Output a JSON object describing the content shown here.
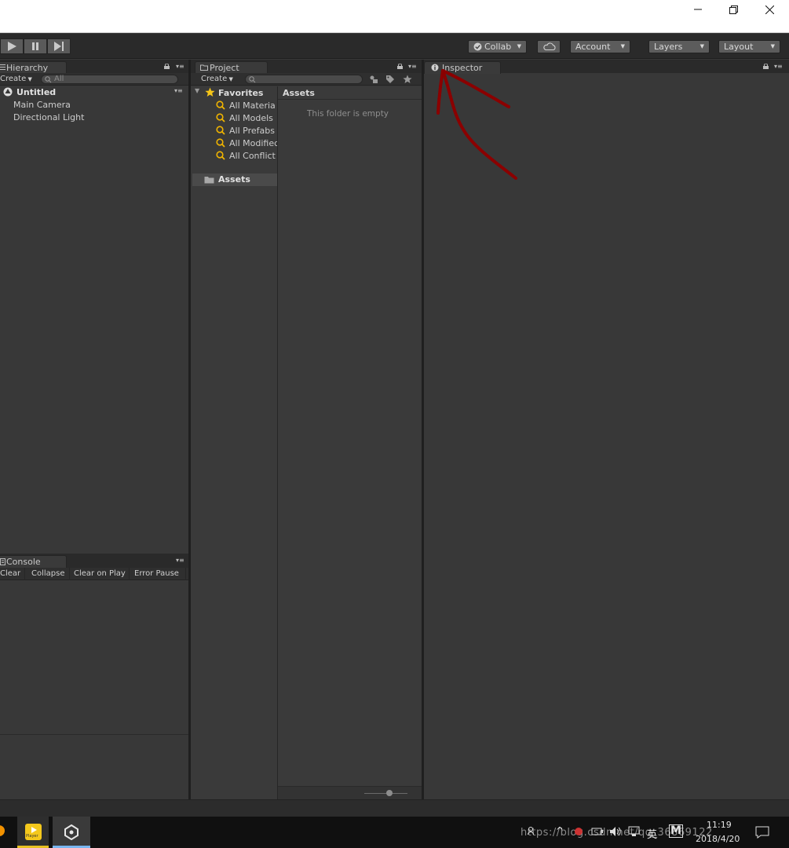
{
  "window": {
    "minimize": "minimize",
    "restore": "restore",
    "close": "close"
  },
  "toolbar": {
    "collab_label": "Collab",
    "account_label": "Account",
    "layers_label": "Layers",
    "layout_label": "Layout"
  },
  "hierarchy": {
    "tab_label": "Hierarchy",
    "create_label": "Create",
    "search_placeholder": "All",
    "scene_name": "Untitled",
    "items": [
      "Main Camera",
      "Directional Light"
    ]
  },
  "project": {
    "tab_label": "Project",
    "create_label": "Create",
    "favorites_label": "Favorites",
    "favorites": [
      "All Materia",
      "All Models",
      "All Prefabs",
      "All Modified",
      "All Conflict"
    ],
    "assets_label": "Assets",
    "breadcrumb": "Assets",
    "empty_message": "This folder is empty"
  },
  "inspector": {
    "tab_label": "Inspector"
  },
  "console": {
    "tab_label": "Console",
    "buttons": [
      "Clear",
      "Collapse",
      "Clear on Play",
      "Error Pause"
    ]
  },
  "taskbar": {
    "player_label": "Player",
    "time": "11:19",
    "date": "2018/4/20",
    "ime_label": "英",
    "m_label": "M",
    "watermark": "https://blog.csdn.net/qq_36869122"
  },
  "colors": {
    "accent_arrow": "#8b0000",
    "star": "#f5c518",
    "search_icon": "#f0b400"
  }
}
